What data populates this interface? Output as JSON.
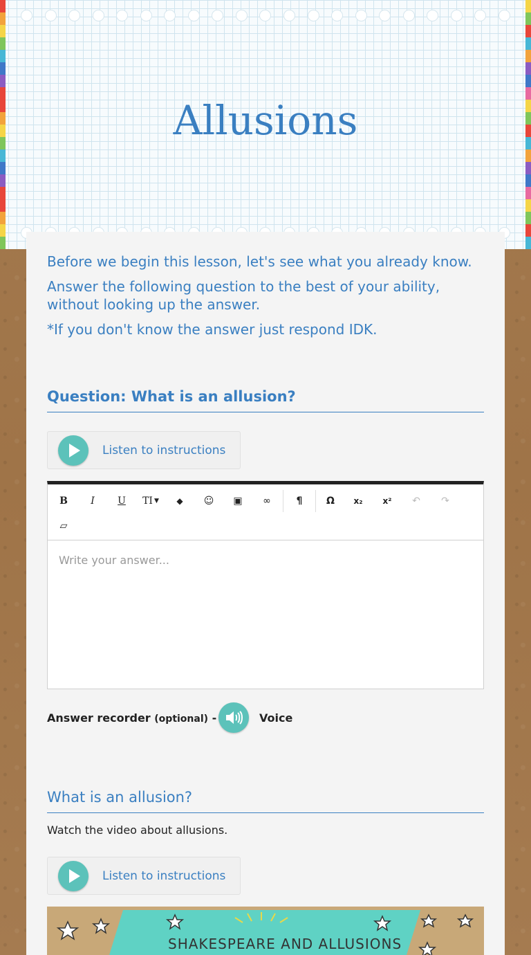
{
  "header": {
    "title": "Allusions"
  },
  "intro": {
    "line1": "Before we begin this lesson, let's see what you already know.",
    "line2": "Answer the following question to the best of your ability, without looking up the answer.",
    "line3": "*If you don't know the answer just respond IDK."
  },
  "question": {
    "title": "Question: What is an allusion?",
    "listen_label": "Listen to instructions",
    "toolbar": {
      "bold": "B",
      "italic": "I",
      "underline": "U",
      "text_size": "TI",
      "color": "◆",
      "emoji": "☺",
      "image": "▣",
      "link": "∞",
      "paragraph": "¶",
      "omega": "Ω",
      "subscript": "x₂",
      "superscript": "x²",
      "undo": "↶",
      "redo": "↷",
      "eraser": "▱"
    },
    "answer_placeholder": "Write your answer..."
  },
  "recorder": {
    "label": "Answer recorder",
    "optional": "(optional)",
    "dash": "-",
    "voice_label": "Voice"
  },
  "section2": {
    "title": "What is an allusion?",
    "text": "Watch the video about allusions.",
    "listen_label": "Listen to instructions",
    "video_caption": "Shakespeare and Allusions"
  },
  "colors": {
    "accent": "#3a7fc1",
    "play": "#5cc2ba",
    "board": "#a67c52",
    "video_banner": "#5fd2c4"
  }
}
